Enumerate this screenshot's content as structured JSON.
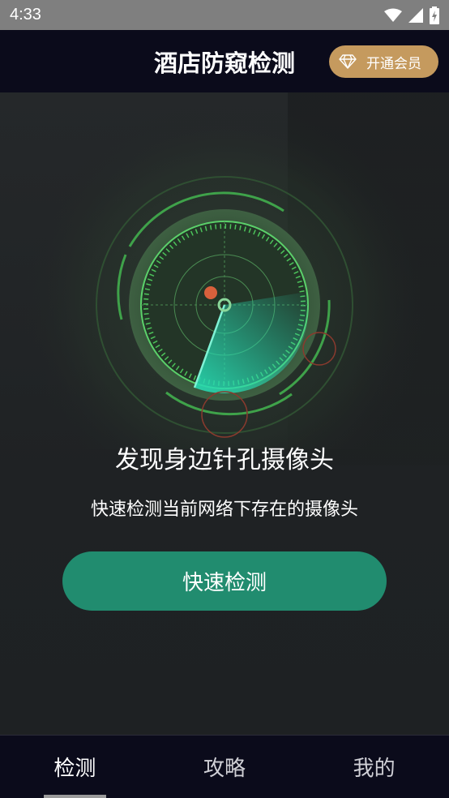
{
  "status_bar": {
    "time": "4:33",
    "icons": [
      "wifi-icon",
      "signal-icon",
      "battery-charging-icon"
    ]
  },
  "header": {
    "title": "酒店防窥检测",
    "vip_button": {
      "label": "开通会员",
      "icon": "diamond-icon"
    }
  },
  "colors": {
    "accent_green": "#218c6f",
    "radar_green": "#4cc35a",
    "vip_gold": "#c59a5e",
    "dark_bar": "#0b0b1b"
  },
  "main": {
    "headline": "发现身边针孔摄像头",
    "subline": "快速检测当前网络下存在的摄像头",
    "scan_button": "快速检测"
  },
  "bottom_nav": {
    "items": [
      {
        "label": "检测",
        "active": true
      },
      {
        "label": "攻略",
        "active": false
      },
      {
        "label": "我的",
        "active": false
      }
    ]
  }
}
